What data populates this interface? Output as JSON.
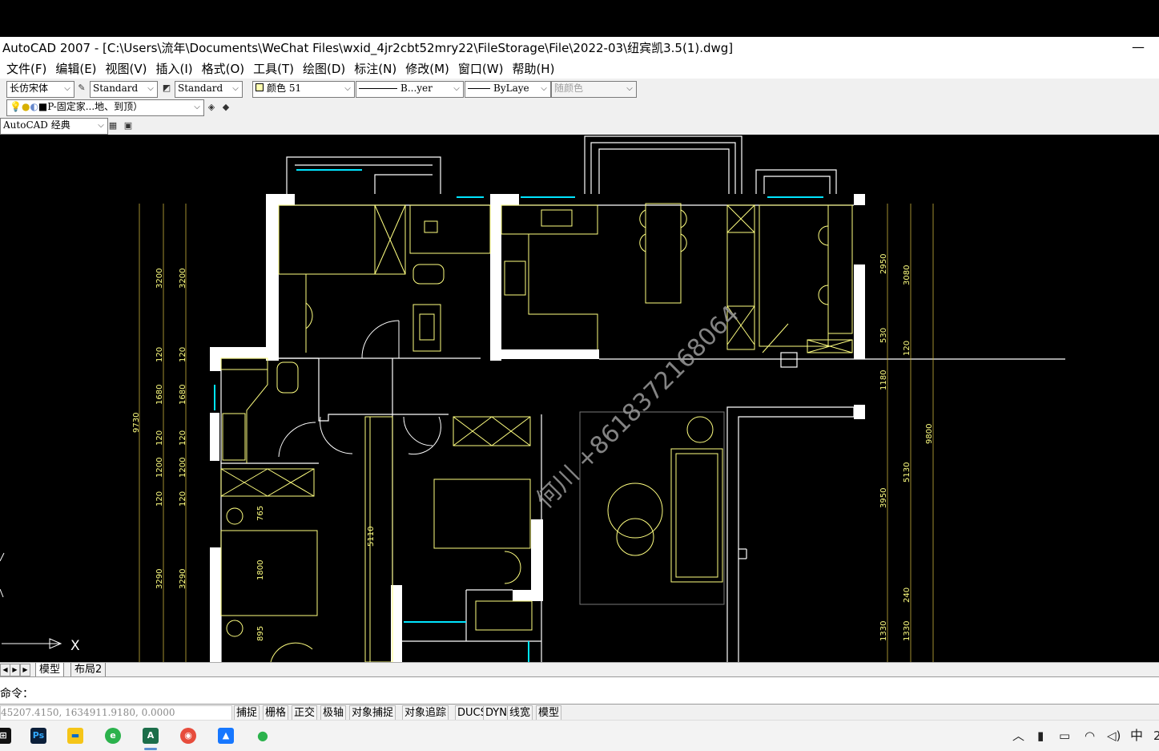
{
  "window": {
    "title": "AutoCAD 2007 - [C:\\Users\\流年\\Documents\\WeChat Files\\wxid_4jr2cbt52mry22\\FileStorage\\File\\2022-03\\纽宾凯3.5(1).dwg]",
    "minimize_glyph": "—"
  },
  "menu": [
    "文件(F)",
    "编辑(E)",
    "视图(V)",
    "插入(I)",
    "格式(O)",
    "工具(T)",
    "绘图(D)",
    "标注(N)",
    "修改(M)",
    "窗口(W)",
    "帮助(H)"
  ],
  "toolbar": {
    "font_combo": "长仿宋体",
    "text_style": "Standard",
    "dim_style": "Standard",
    "color_combo": "颜色 51",
    "linetype_combo": "B...yer",
    "lineweight_combo": "ByLaye",
    "plotstyle_combo": "随颜色",
    "layer_combo": "P-固定家...地、到顶）",
    "workspace_combo": "AutoCAD 经典"
  },
  "drawing": {
    "left_dims_outer": [
      "9730"
    ],
    "left_dims_a": [
      "3200",
      "120",
      "1680",
      "120",
      "1200",
      "120",
      "3290"
    ],
    "left_dims_b": [
      "3200",
      "120",
      "1680",
      "120",
      "1200",
      "120",
      "3290"
    ],
    "room_dims": [
      "765",
      "1800",
      "895",
      "5110"
    ],
    "right_dims_a": [
      "2950",
      "530",
      "1180",
      "3950",
      "1330"
    ],
    "right_dims_b": [
      "3080",
      "120",
      "5130",
      "240",
      "1330"
    ],
    "right_dims_c": [
      "9800"
    ],
    "watermark": "何川  +8618372168064",
    "ucs_x": "X"
  },
  "tabs": {
    "model": "模型",
    "layout2": "布局2"
  },
  "command": {
    "label": "命令："
  },
  "status": {
    "coords": "45207.4150, 1634911.9180, 0.0000",
    "buttons": [
      "捕捉",
      "栅格",
      "正交",
      "极轴",
      "对象捕捉",
      "对象追踪",
      "DUCS",
      "DYN",
      "线宽",
      "模型"
    ]
  },
  "taskbar": {
    "ime": "中",
    "clock_fragment": "2"
  },
  "colors": {
    "wall": "#ffffff",
    "furniture": "#ffff80",
    "dimension": "#c8b23c",
    "glass": "#00e5ff",
    "watermark": "#9a9a9a"
  }
}
